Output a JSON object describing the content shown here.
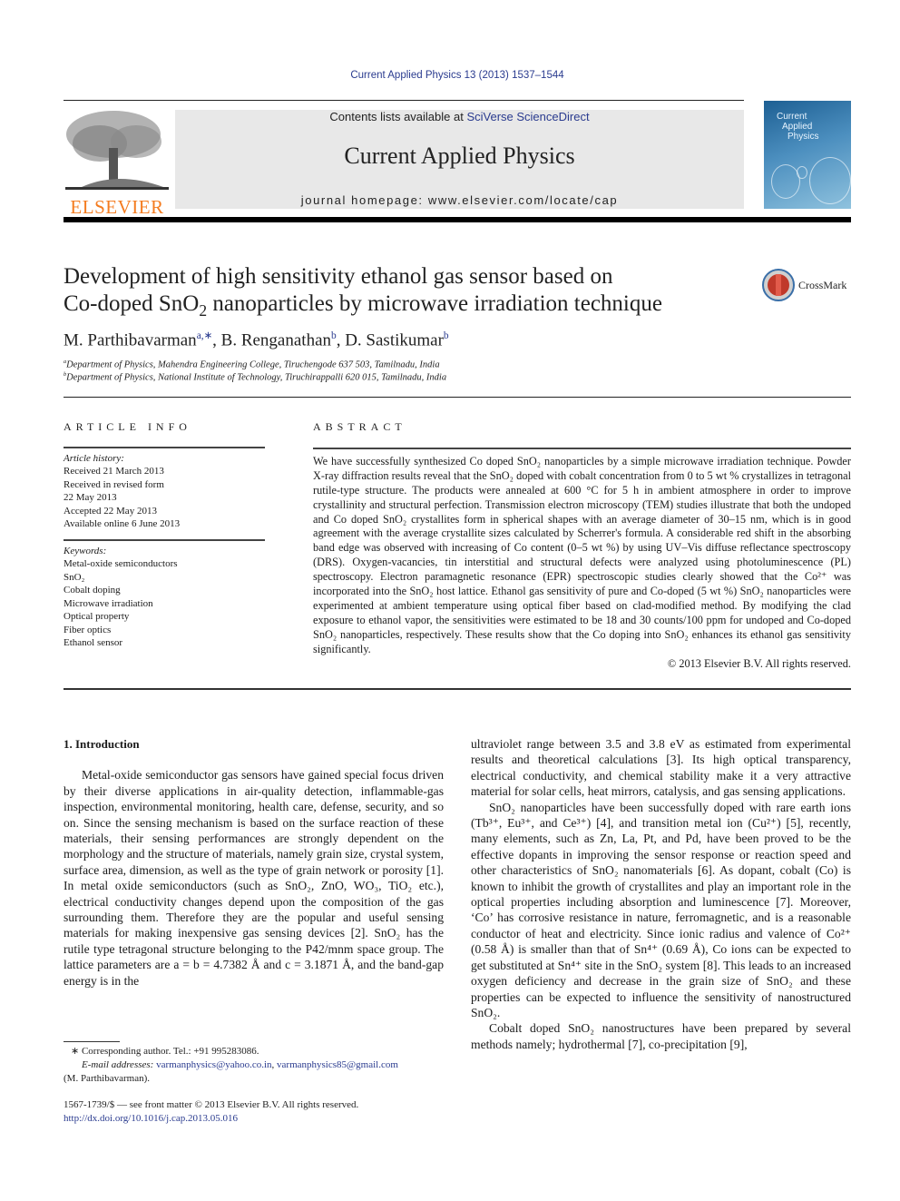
{
  "header": {
    "journal_ref": "Current Applied Physics 13 (2013) 1537–1544",
    "contents_prefix": "Contents lists available at ",
    "contents_link": "SciVerse ScienceDirect",
    "journal_title": "Current Applied Physics",
    "homepage": "journal homepage: www.elsevier.com/locate/cap",
    "publisher_logo": "ELSEVIER",
    "cover_title": [
      "Current",
      "Applied",
      "Physics"
    ]
  },
  "article": {
    "title_line1": "Development of high sensitivity ethanol gas sensor based on",
    "title_line2_a": "Co-doped SnO",
    "title_line2_sub": "2",
    "title_line2_b": " nanoparticles by microwave irradiation technique",
    "crossmark": "CrossMark",
    "authors": [
      {
        "name": "M. Parthibavarman",
        "sup": "a,∗"
      },
      {
        "name": "B. Renganathan",
        "sup": "b"
      },
      {
        "name": "D. Sastikumar",
        "sup": "b"
      }
    ],
    "affiliations": [
      {
        "sup": "a",
        "text": "Department of Physics, Mahendra Engineering College, Tiruchengode 637 503, Tamilnadu, India"
      },
      {
        "sup": "b",
        "text": "Department of Physics, National Institute of Technology, Tiruchirappalli 620 015, Tamilnadu, India"
      }
    ]
  },
  "article_info": {
    "label": "ARTICLE INFO",
    "history_label": "Article history:",
    "history": [
      "Received 21 March 2013",
      "Received in revised form",
      "22 May 2013",
      "Accepted 22 May 2013",
      "Available online 6 June 2013"
    ],
    "keywords_label": "Keywords:",
    "keywords": [
      "Metal-oxide semiconductors",
      "SnO₂",
      "Cobalt doping",
      "Microwave irradiation",
      "Optical property",
      "Fiber optics",
      "Ethanol sensor"
    ]
  },
  "abstract": {
    "label": "ABSTRACT",
    "text": "We have successfully synthesized Co doped SnO₂ nanoparticles by a simple microwave irradiation technique. Powder X-ray diffraction results reveal that the SnO₂ doped with cobalt concentration from 0 to 5 wt % crystallizes in tetragonal rutile-type structure. The products were annealed at 600 °C for 5 h in ambient atmosphere in order to improve crystallinity and structural perfection. Transmission electron microscopy (TEM) studies illustrate that both the undoped and Co doped SnO₂ crystallites form in spherical shapes with an average diameter of 30–15 nm, which is in good agreement with the average crystallite sizes calculated by Scherrer's formula. A considerable red shift in the absorbing band edge was observed with increasing of Co content (0–5 wt %) by using UV–Vis diffuse reflectance spectroscopy (DRS). Oxygen-vacancies, tin interstitial and structural defects were analyzed using photoluminescence (PL) spectroscopy. Electron paramagnetic resonance (EPR) spectroscopic studies clearly showed that the Co²⁺ was incorporated into the SnO₂ host lattice. Ethanol gas sensitivity of pure and Co-doped (5 wt %) SnO₂ nanoparticles were experimented at ambient temperature using optical fiber based on clad-modified method. By modifying the clad exposure to ethanol vapor, the sensitivities were estimated to be 18 and 30 counts/100 ppm for undoped and Co-doped SnO₂ nanoparticles, respectively. These results show that the Co doping into SnO₂ enhances its ethanol gas sensitivity significantly.",
    "copyright": "© 2013 Elsevier B.V. All rights reserved."
  },
  "body": {
    "section_heading": "1.  Introduction",
    "left_para": "Metal-oxide semiconductor gas sensors have gained special focus driven by their diverse applications in air-quality detection, inflammable-gas inspection, environmental monitoring, health care, defense, security, and so on. Since the sensing mechanism is based on the surface reaction of these materials, their sensing performances are strongly dependent on the morphology and the structure of materials, namely grain size, crystal system, surface area, dimension, as well as the type of grain network or porosity [1]. In metal oxide semiconductors (such as SnO₂, ZnO, WO₃, TiO₂ etc.), electrical conductivity changes depend upon the composition of the gas surrounding them. Therefore they are the popular and useful sensing materials for making inexpensive gas sensing devices [2]. SnO₂ has the rutile type tetragonal structure belonging to the P42/mnm space group. The lattice parameters are a = b = 4.7382 Å and c = 3.1871 Å, and the band-gap energy is in the",
    "right_para1": "ultraviolet range between 3.5 and 3.8 eV as estimated from experimental results and theoretical calculations [3]. Its high optical transparency, electrical conductivity, and chemical stability make it a very attractive material for solar cells, heat mirrors, catalysis, and gas sensing applications.",
    "right_para2": "SnO₂ nanoparticles have been successfully doped with rare earth ions (Tb³⁺, Eu³⁺, and Ce³⁺) [4], and transition metal ion (Cu²⁺) [5], recently, many elements, such as Zn, La, Pt, and Pd, have been proved to be the effective dopants in improving the sensor response or reaction speed and other characteristics of SnO₂ nanomaterials [6]. As dopant, cobalt (Co) is known to inhibit the growth of crystallites and play an important role in the optical properties including absorption and luminescence [7]. Moreover, ‘Co’ has corrosive resistance in nature, ferromagnetic, and is a reasonable conductor of heat and electricity. Since ionic radius and valence of Co²⁺ (0.58 Å) is smaller than that of Sn⁴⁺ (0.69 Å), Co ions can be expected to get substituted at Sn⁴⁺ site in the SnO₂ system [8]. This leads to an increased oxygen deficiency and decrease in the grain size of SnO₂ and these properties can be expected to influence the sensitivity of nanostructured SnO₂.",
    "right_para3": "Cobalt doped SnO₂ nanostructures have been prepared by several methods namely; hydrothermal [7], co-precipitation [9],"
  },
  "footnotes": {
    "corresponding": "∗  Corresponding author. Tel.: +91 995283086.",
    "email_label": "E-mail addresses: ",
    "email1": "varmanphysics@yahoo.co.in",
    "email2": "varmanphysics85@gmail.com",
    "email_owner": "(M. Parthibavarman).",
    "issn": "1567-1739/$ — see front matter © 2013 Elsevier B.V. All rights reserved.",
    "doi": "http://dx.doi.org/10.1016/j.cap.2013.05.016"
  }
}
